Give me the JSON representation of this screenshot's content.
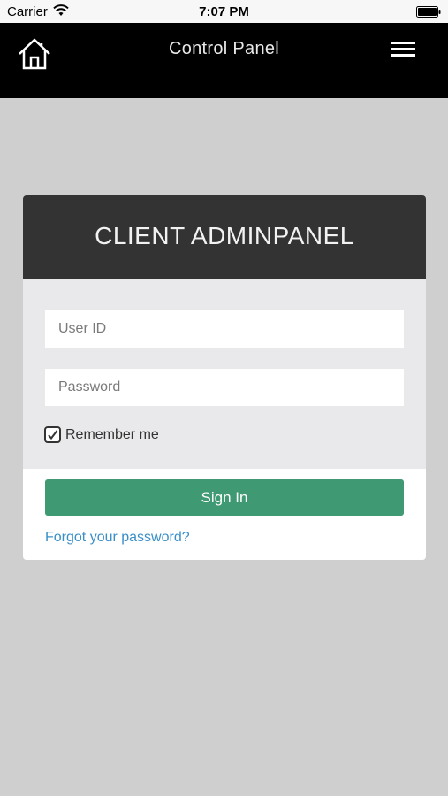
{
  "status_bar": {
    "carrier": "Carrier",
    "time": "7:07 PM",
    "wifi_icon": "wifi-icon",
    "battery_icon": "battery-icon"
  },
  "nav": {
    "title": "Control Panel",
    "home_icon": "home-icon",
    "menu_icon": "hamburger-menu-icon"
  },
  "login": {
    "title": "CLIENT ADMINPANEL",
    "user_id": {
      "value": "",
      "placeholder": "User ID"
    },
    "password": {
      "value": "",
      "placeholder": "Password"
    },
    "remember_me": {
      "label": "Remember me",
      "checked": true
    },
    "sign_in_label": "Sign In",
    "forgot_link": "Forgot your password?"
  },
  "colors": {
    "nav_background": "#000000",
    "card_header": "#333333",
    "form_background": "#e9e9eb",
    "page_background": "#cfcfcf",
    "sign_in_button": "#3f9a73",
    "link": "#3a8fc7"
  }
}
